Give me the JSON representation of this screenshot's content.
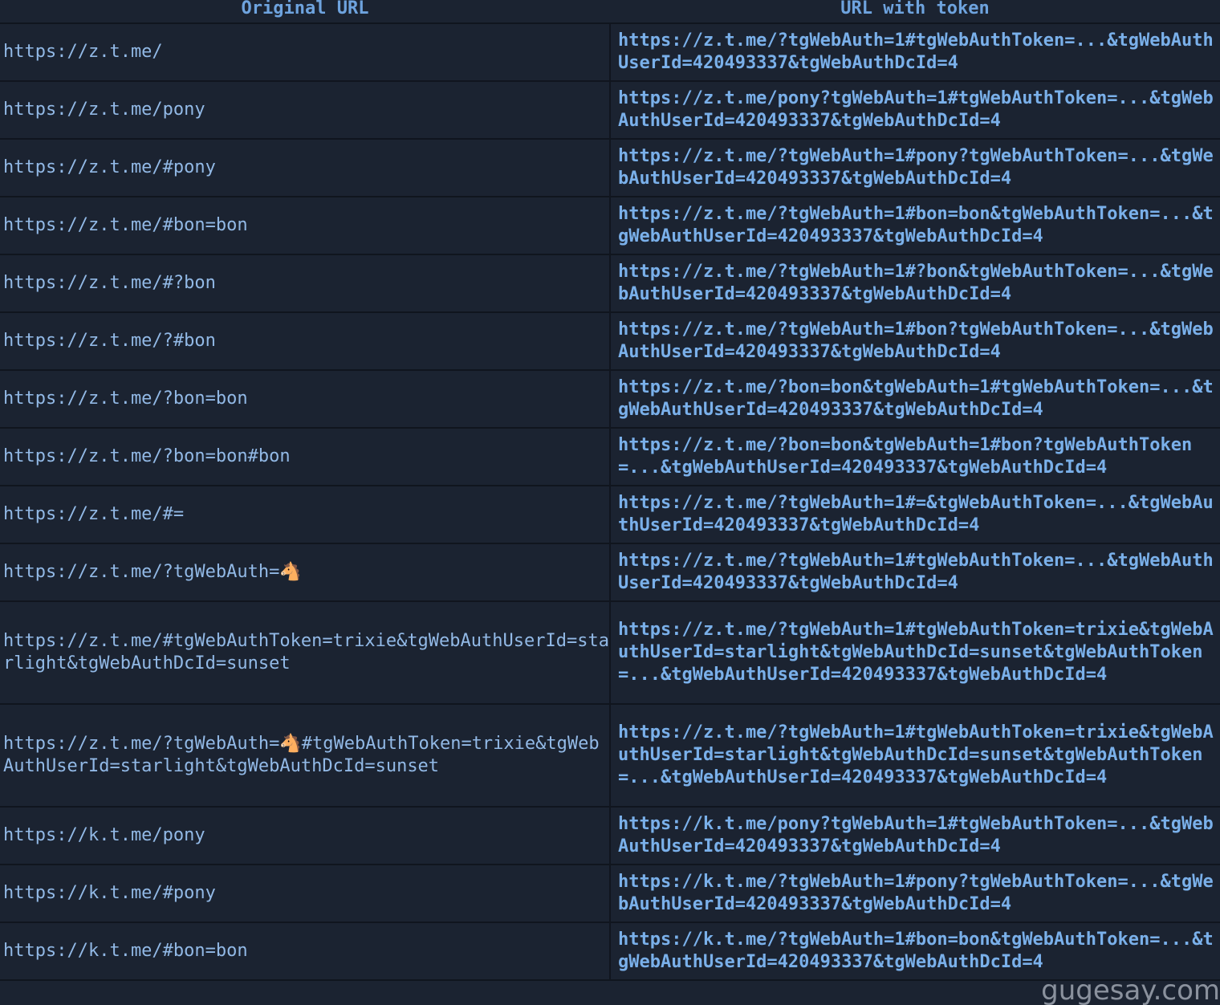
{
  "table": {
    "headers": [
      "Original URL",
      "URL with token"
    ],
    "rows": [
      {
        "original": "https://z.t.me/",
        "token": "https://z.t.me/?tgWebAuth=1#tgWebAuthToken=...&tgWebAuthUserId=420493337&tgWebAuthDcId=4",
        "lines": 2
      },
      {
        "original": "https://z.t.me/pony",
        "token": "https://z.t.me/pony?tgWebAuth=1#tgWebAuthToken=...&tgWebAuthUserId=420493337&tgWebAuthDcId=4",
        "lines": 2
      },
      {
        "original": "https://z.t.me/#pony",
        "token": "https://z.t.me/?tgWebAuth=1#pony?tgWebAuthToken=...&tgWebAuthUserId=420493337&tgWebAuthDcId=4",
        "lines": 2
      },
      {
        "original": "https://z.t.me/#bon=bon",
        "token": "https://z.t.me/?tgWebAuth=1#bon=bon&tgWebAuthToken=...&tgWebAuthUserId=420493337&tgWebAuthDcId=4",
        "lines": 2
      },
      {
        "original": "https://z.t.me/#?bon",
        "token": "https://z.t.me/?tgWebAuth=1#?bon&tgWebAuthToken=...&tgWebAuthUserId=420493337&tgWebAuthDcId=4",
        "lines": 2
      },
      {
        "original": "https://z.t.me/?#bon",
        "token": "https://z.t.me/?tgWebAuth=1#bon?tgWebAuthToken=...&tgWebAuthUserId=420493337&tgWebAuthDcId=4",
        "lines": 2
      },
      {
        "original": "https://z.t.me/?bon=bon",
        "token": "https://z.t.me/?bon=bon&tgWebAuth=1#tgWebAuthToken=...&tgWebAuthUserId=420493337&tgWebAuthDcId=4",
        "lines": 2
      },
      {
        "original": "https://z.t.me/?bon=bon#bon",
        "token": "https://z.t.me/?bon=bon&tgWebAuth=1#bon?tgWebAuthToken=...&tgWebAuthUserId=420493337&tgWebAuthDcId=4",
        "lines": 2
      },
      {
        "original": "https://z.t.me/#=",
        "token": "https://z.t.me/?tgWebAuth=1#=&tgWebAuthToken=...&tgWebAuthUserId=420493337&tgWebAuthDcId=4",
        "lines": 2
      },
      {
        "original": "https://z.t.me/?tgWebAuth=🐴",
        "token": "https://z.t.me/?tgWebAuth=1#tgWebAuthToken=...&tgWebAuthUserId=420493337&tgWebAuthDcId=4",
        "lines": 2
      },
      {
        "original": "https://z.t.me/#tgWebAuthToken=trixie&tgWebAuthUserId=starlight&tgWebAuthDcId=sunset",
        "token": "https://z.t.me/?tgWebAuth=1#tgWebAuthToken=trixie&tgWebAuthUserId=starlight&tgWebAuthDcId=sunset&tgWebAuthToken=...&tgWebAuthUserId=420493337&tgWebAuthDcId=4",
        "lines": 4
      },
      {
        "original": "https://z.t.me/?tgWebAuth=🐴#tgWebAuthToken=trixie&tgWebAuthUserId=starlight&tgWebAuthDcId=sunset",
        "token": "https://z.t.me/?tgWebAuth=1#tgWebAuthToken=trixie&tgWebAuthUserId=starlight&tgWebAuthDcId=sunset&tgWebAuthToken=...&tgWebAuthUserId=420493337&tgWebAuthDcId=4",
        "lines": 4
      },
      {
        "original": "https://k.t.me/pony",
        "token": "https://k.t.me/pony?tgWebAuth=1#tgWebAuthToken=...&tgWebAuthUserId=420493337&tgWebAuthDcId=4",
        "lines": 2
      },
      {
        "original": "https://k.t.me/#pony",
        "token": "https://k.t.me/?tgWebAuth=1#pony?tgWebAuthToken=...&tgWebAuthUserId=420493337&tgWebAuthDcId=4",
        "lines": 2
      },
      {
        "original": "https://k.t.me/#bon=bon",
        "token": "https://k.t.me/?tgWebAuth=1#bon=bon&tgWebAuthToken=...&tgWebAuthUserId=420493337&tgWebAuthDcId=4",
        "lines": 2
      }
    ]
  },
  "watermark": "gugesay.com"
}
